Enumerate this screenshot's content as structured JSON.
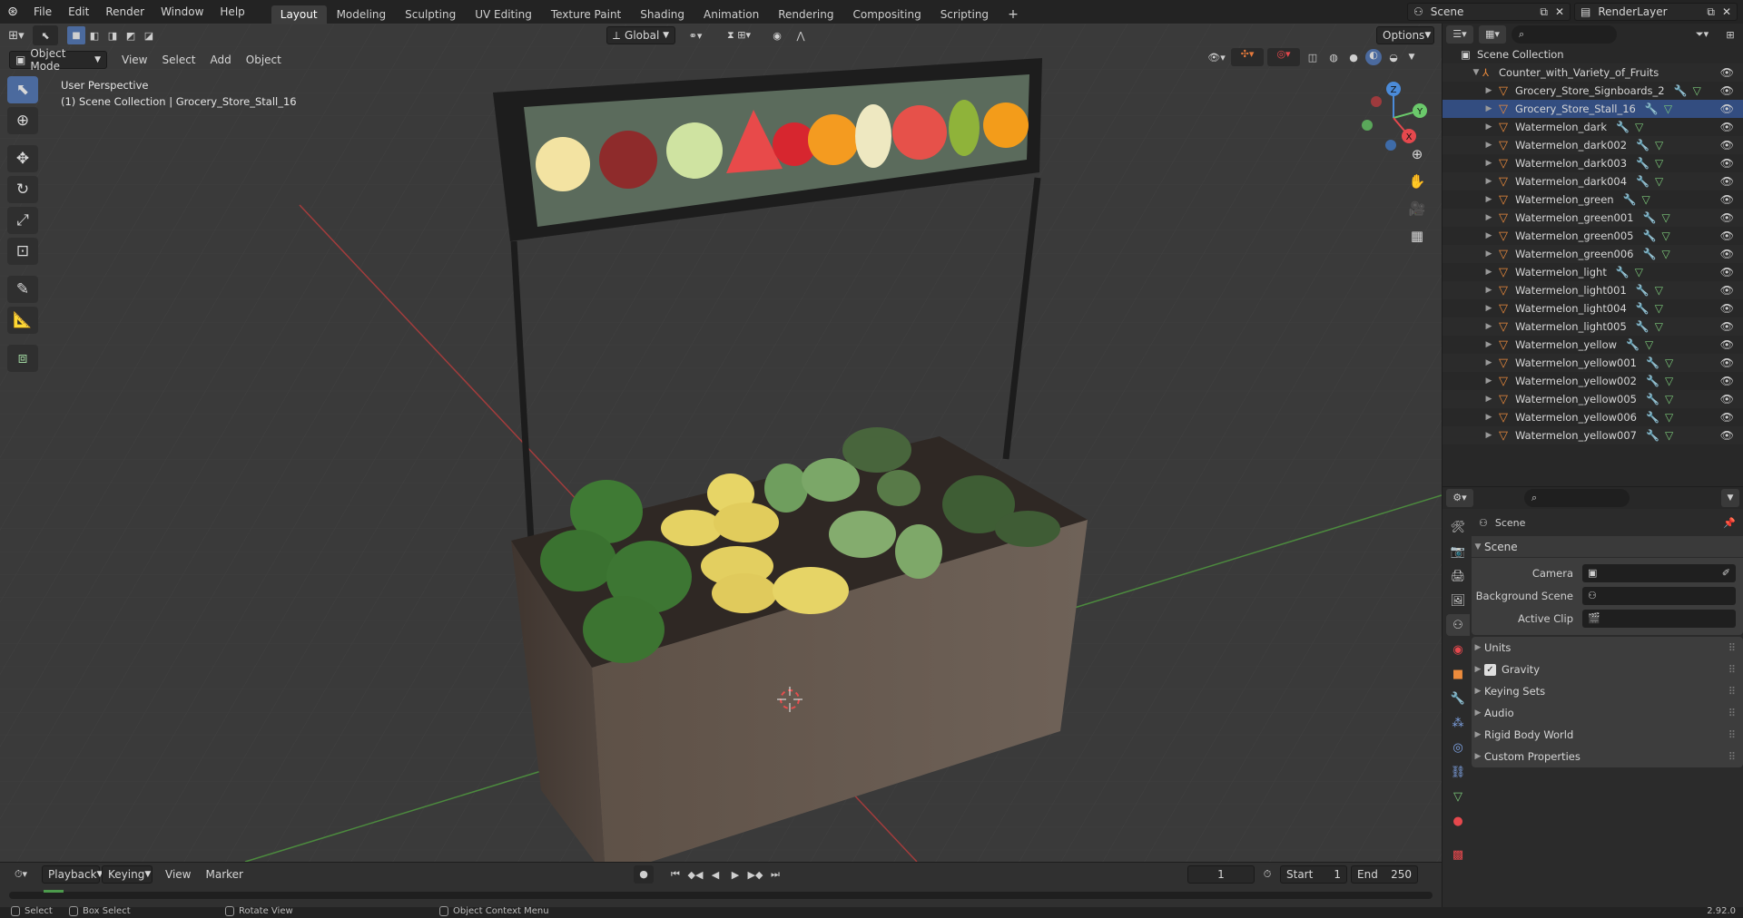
{
  "topbar": {
    "menus": [
      "File",
      "Edit",
      "Render",
      "Window",
      "Help"
    ],
    "workspaces": [
      "Layout",
      "Modeling",
      "Sculpting",
      "UV Editing",
      "Texture Paint",
      "Shading",
      "Animation",
      "Rendering",
      "Compositing",
      "Scripting"
    ],
    "active_workspace": "Layout",
    "add_tab": "+",
    "scene_name": "Scene",
    "view_layer": "RenderLayer"
  },
  "viewport": {
    "mode": "Object Mode",
    "menus": [
      "View",
      "Select",
      "Add",
      "Object"
    ],
    "transform_orientation": "Global",
    "options_label": "Options",
    "info_line1": "User Perspective",
    "info_line2": "(1) Scene Collection | Grocery_Store_Stall_16",
    "gizmo_axes": {
      "z": "Z",
      "y": "Y",
      "x": "X"
    }
  },
  "outliner": {
    "root": "Scene Collection",
    "collection": "Counter_with_Variety_of_Fruits",
    "items": [
      "Grocery_Store_Signboards_2",
      "Grocery_Store_Stall_16",
      "Watermelon_dark",
      "Watermelon_dark002",
      "Watermelon_dark003",
      "Watermelon_dark004",
      "Watermelon_green",
      "Watermelon_green001",
      "Watermelon_green005",
      "Watermelon_green006",
      "Watermelon_light",
      "Watermelon_light001",
      "Watermelon_light004",
      "Watermelon_light005",
      "Watermelon_yellow",
      "Watermelon_yellow001",
      "Watermelon_yellow002",
      "Watermelon_yellow005",
      "Watermelon_yellow006",
      "Watermelon_yellow007"
    ],
    "selected_item": "Grocery_Store_Stall_16"
  },
  "properties": {
    "context_title": "Scene",
    "panel_title": "Scene",
    "camera_label": "Camera",
    "background_scene_label": "Background Scene",
    "active_clip_label": "Active Clip",
    "subpanels": [
      "Units",
      "Gravity",
      "Keying Sets",
      "Audio",
      "Rigid Body World",
      "Custom Properties"
    ],
    "gravity_checked": true
  },
  "timeline": {
    "playback_label": "Playback",
    "keying_label": "Keying",
    "view_label": "View",
    "marker_label": "Marker",
    "current_frame": "1",
    "start_label": "Start",
    "start_value": "1",
    "end_label": "End",
    "end_value": "250"
  },
  "statusbar": {
    "select": "Select",
    "box_select": "Box Select",
    "rotate_view": "Rotate View",
    "context_menu": "Object Context Menu",
    "version": "2.92.0"
  },
  "colors": {
    "accent": "#4b6a9e",
    "selected_row": "#334d80",
    "object_icon": "#ec8b3c",
    "axis_x": "#e5484d",
    "axis_y": "#6bc96b",
    "axis_z": "#4b8bd9"
  },
  "icons": [
    "blender-logo-icon",
    "select-cursor-icon",
    "cursor-icon",
    "move-icon",
    "rotate-icon",
    "scale-icon",
    "transform-icon",
    "annotate-icon",
    "measure-icon",
    "add-cube-icon",
    "zoom-icon",
    "pan-hand-icon",
    "camera-icon",
    "grid-icon",
    "eye-icon",
    "filter-icon",
    "search-icon"
  ]
}
